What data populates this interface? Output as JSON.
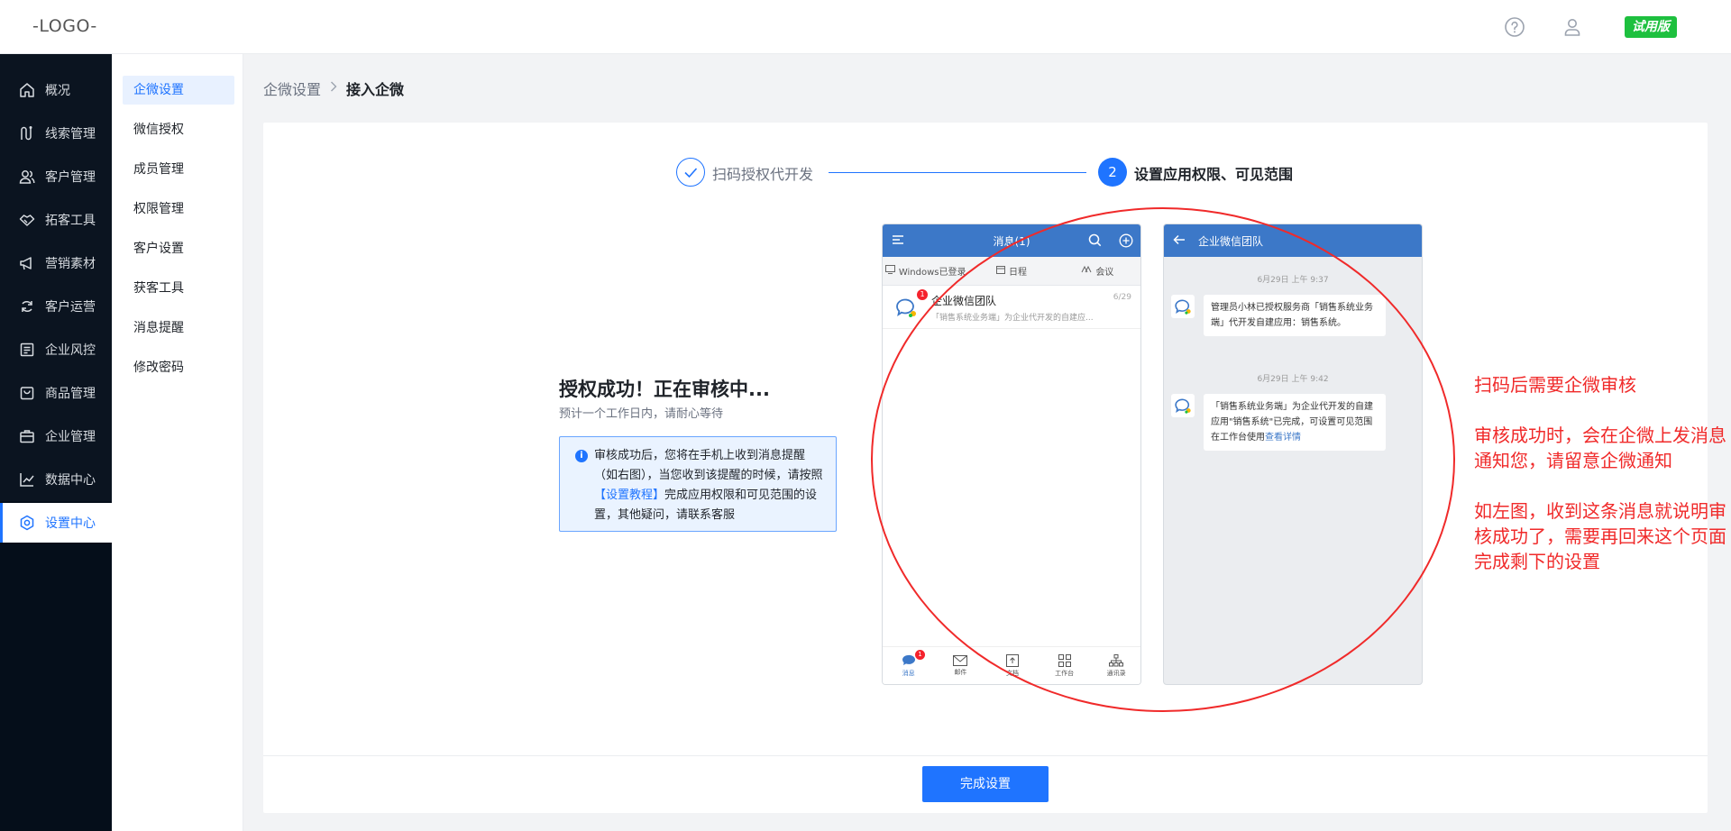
{
  "header": {
    "logo": "-LOGO-",
    "trial_badge": "试用版",
    "icons": [
      "help-icon",
      "user-icon"
    ]
  },
  "sidebar": {
    "items": [
      {
        "label": "概况",
        "icon": "home-icon"
      },
      {
        "label": "线索管理",
        "icon": "route-icon"
      },
      {
        "label": "客户管理",
        "icon": "users-icon"
      },
      {
        "label": "拓客工具",
        "icon": "handshake-icon"
      },
      {
        "label": "营销素材",
        "icon": "megaphone-icon"
      },
      {
        "label": "客户运营",
        "icon": "recycle-icon"
      },
      {
        "label": "企业风控",
        "icon": "document-icon"
      },
      {
        "label": "商品管理",
        "icon": "bag-icon"
      },
      {
        "label": "企业管理",
        "icon": "briefcase-icon"
      },
      {
        "label": "数据中心",
        "icon": "chart-line-icon"
      },
      {
        "label": "设置中心",
        "icon": "settings-icon"
      }
    ],
    "active_index": 10
  },
  "submenu": {
    "items": [
      "企微设置",
      "微信授权",
      "成员管理",
      "权限管理",
      "客户设置",
      "获客工具",
      "消息提醒",
      "修改密码"
    ],
    "active_index": 0
  },
  "breadcrumb": {
    "parent": "企微设置",
    "separator": ">",
    "current": "接入企微"
  },
  "steps": {
    "step1": {
      "label": "扫码授权代开发",
      "status": "done"
    },
    "step2": {
      "number": "2",
      "label": "设置应用权限、可见范围",
      "status": "active"
    }
  },
  "auth": {
    "title": "授权成功！正在审核中...",
    "subtitle": "预计一个工作日内，请耐心等待",
    "notice_icon": "i",
    "notice_text_1": "审核成功后，您将在手机上收到消息提醒（如右图），当您收到该提醒的时候，请按照",
    "notice_link": "【设置教程】",
    "notice_text_2": "完成应用权限和可见范围的设置，其他疑问，请联系客服"
  },
  "phone_list": {
    "title": "消息(1)",
    "tabs": [
      "Windows已登录",
      "日程",
      "会议"
    ],
    "message": {
      "badge": "1",
      "name": "企业微信团队",
      "preview": "「销售系统业务端」为企业代开发的自建应...",
      "date": "6/29"
    },
    "nav": [
      {
        "label": "消息",
        "badge": "1"
      },
      {
        "label": "邮件"
      },
      {
        "label": "文档"
      },
      {
        "label": "工作台"
      },
      {
        "label": "通讯录"
      }
    ]
  },
  "phone_chat": {
    "title": "企业微信团队",
    "time_1": "6月29日 上午 9:37",
    "msg_1": "管理员小林已授权服务商「销售系统业务端」代开发自建应用：销售系统。",
    "time_2": "6月29日 上午 9:42",
    "msg_2": "「销售系统业务端」为企业代开发的自建应用\"销售系统\"已完成，可设置可见范围在工作台使用",
    "msg_2_link": "查看详情"
  },
  "annotation": {
    "note_1": "扫码后需要企微审核",
    "note_2": "审核成功时，会在企微上发消息通知您，请留意企微通知",
    "note_3": "如左图，收到这条消息就说明审核成功了，需要再回来这个页面完成剩下的设置",
    "color": "#f02a2a"
  },
  "actions": {
    "finish": "完成设置"
  },
  "colors": {
    "primary": "#1f74ff",
    "sidebar_bg": "#050e1a",
    "trial_badge": "#1ec03f"
  }
}
